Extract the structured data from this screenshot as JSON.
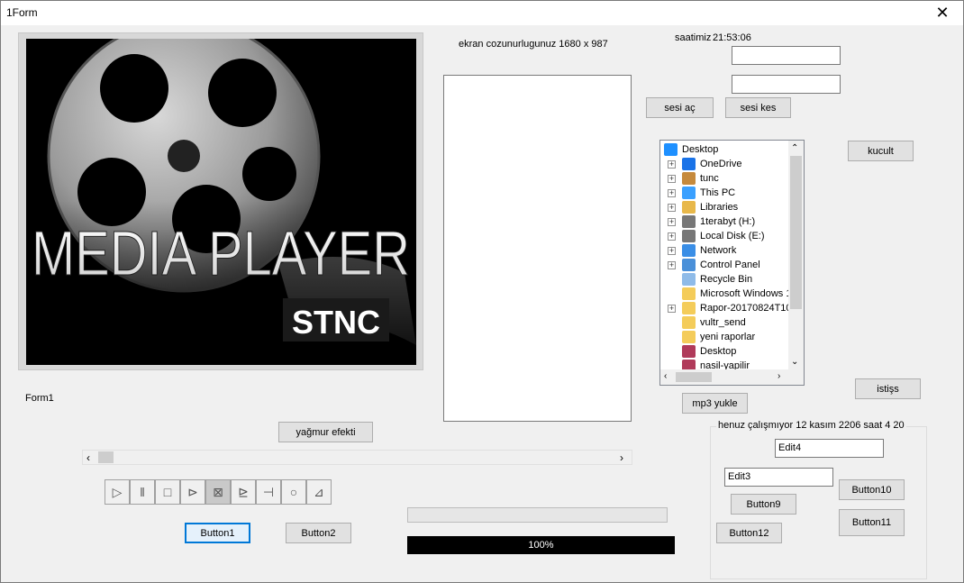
{
  "window": {
    "title": "1Form",
    "close_glyph": "✕"
  },
  "media_image": {
    "line1": "MEDIA PLAYER",
    "line2": "STNC"
  },
  "labels": {
    "resolution": "ekran cozunurlugunuz 1680 x 987",
    "clock_prefix": "saatimiz",
    "clock_time": "21:53:06",
    "form1": "Form1"
  },
  "inputs": {
    "edit_top1": "",
    "edit_top2": "",
    "edit4": "Edit4",
    "edit3": "Edit3"
  },
  "buttons": {
    "sesi_ac": "sesi aç",
    "sesi_kes": "sesi kes",
    "kucult": "kucult",
    "istisis": "istişs",
    "mp3_yukle": "mp3 yukle",
    "yagmur": "yağmur efekti",
    "button1": "Button1",
    "button2": "Button2",
    "button9": "Button9",
    "button10": "Button10",
    "button11": "Button11",
    "button12": "Button12"
  },
  "tree": {
    "items": [
      {
        "label": "Desktop",
        "icon": "desktop-icon",
        "expander": false,
        "level": 0
      },
      {
        "label": "OneDrive",
        "icon": "cloud-icon",
        "expander": true,
        "level": 1
      },
      {
        "label": "tunc",
        "icon": "user-icon",
        "expander": true,
        "level": 1
      },
      {
        "label": "This PC",
        "icon": "computer-icon",
        "expander": true,
        "level": 1
      },
      {
        "label": "Libraries",
        "icon": "library-icon",
        "expander": true,
        "level": 1
      },
      {
        "label": "1terabyt (H:)",
        "icon": "drive-icon",
        "expander": true,
        "level": 1
      },
      {
        "label": "Local Disk (E:)",
        "icon": "drive-icon",
        "expander": true,
        "level": 1
      },
      {
        "label": "Network",
        "icon": "network-icon",
        "expander": true,
        "level": 1
      },
      {
        "label": "Control Panel",
        "icon": "control-panel-icon",
        "expander": true,
        "level": 1
      },
      {
        "label": "Recycle Bin",
        "icon": "recycle-bin-icon",
        "expander": false,
        "level": 1
      },
      {
        "label": "Microsoft Windows 1",
        "icon": "folder-icon",
        "expander": false,
        "level": 1
      },
      {
        "label": "Rapor-20170824T10",
        "icon": "folder-icon",
        "expander": true,
        "level": 1
      },
      {
        "label": "vultr_send",
        "icon": "folder-icon",
        "expander": false,
        "level": 1
      },
      {
        "label": "yeni raporlar",
        "icon": "folder-icon",
        "expander": false,
        "level": 1
      },
      {
        "label": "Desktop",
        "icon": "archive-icon",
        "expander": false,
        "level": 1
      },
      {
        "label": "nasil-yapilir",
        "icon": "archive-icon",
        "expander": false,
        "level": 1
      }
    ]
  },
  "groupbox": {
    "legend": "henuz çalışmıyor 12 kasım 2206 saat 4 20"
  },
  "progress": {
    "value_text": "100%",
    "value": 1.0
  },
  "media_buttons": [
    {
      "name": "play-icon"
    },
    {
      "name": "pause-icon"
    },
    {
      "name": "stop-icon"
    },
    {
      "name": "next-icon"
    },
    {
      "name": "back-icon"
    },
    {
      "name": "step-icon"
    },
    {
      "name": "eject-icon"
    },
    {
      "name": "record-icon"
    },
    {
      "name": "eject2-icon"
    }
  ]
}
